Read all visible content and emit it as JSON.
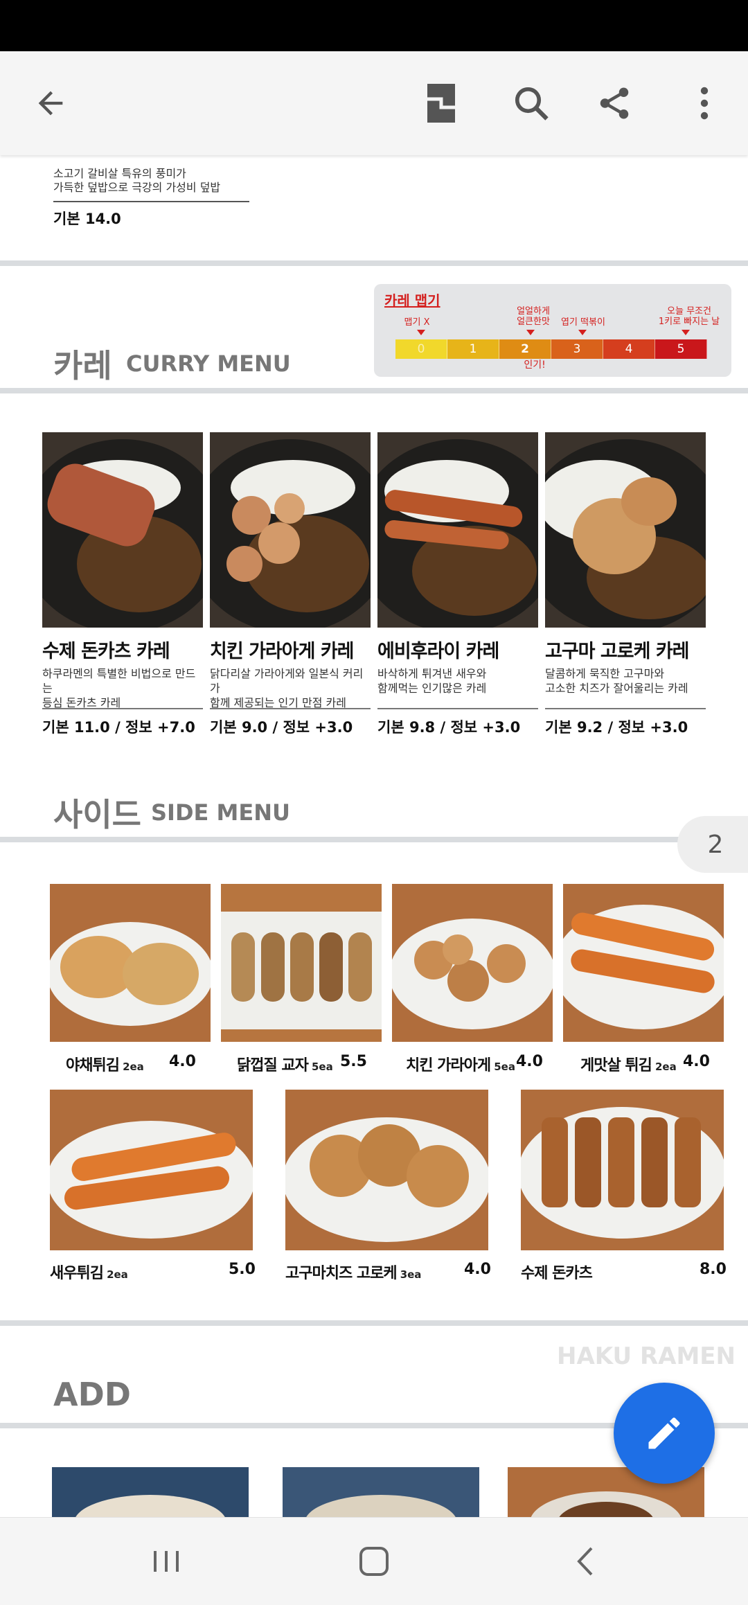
{
  "toolbar": {
    "back": "back-arrow-icon",
    "icons": [
      "page-icon",
      "search-icon",
      "share-icon",
      "more-icon"
    ]
  },
  "top_item": {
    "desc_line1": "소고기 갈비살 특유의 풍미가",
    "desc_line2": "가득한 덮밥으로 극강의 가성비 덮밥",
    "price": "기본  14.0"
  },
  "curry": {
    "title_ko": "카레",
    "title_en": "CURRY MENU",
    "spice": {
      "title": "카레 맵기",
      "labels": [
        "맵기 X",
        "얼얼하게\n얼큰한맛",
        "엽기 떡볶이",
        "오늘 무조건\n1키로 빠지는 날"
      ],
      "levels": [
        "0",
        "1",
        "2",
        "3",
        "4",
        "5"
      ],
      "popular": "인기!"
    },
    "items": [
      {
        "name": "수제 돈카츠 카레",
        "desc1": "하쿠라멘의 특별한 비법으로 만드는",
        "desc2": "등심 돈카츠 카레",
        "price": "기본  11.0   / 정보  +7.0"
      },
      {
        "name": "치킨 가라아게 카레",
        "desc1": "닭다리살 가라아게와 일본식 커리가",
        "desc2": "함께 제공되는 인기 만점 카레",
        "price": "기본  9.0   / 정보  +3.0"
      },
      {
        "name": "에비후라이 카레",
        "desc1": "바삭하게 튀겨낸 새우와",
        "desc2": "함께먹는 인기많은 카레",
        "price": "기본  9.8   / 정보  +3.0"
      },
      {
        "name": "고구마 고로케 카레",
        "desc1": "달콤하게 묵직한 고구마와",
        "desc2": "고소한 치즈가 잘어울리는 카레",
        "price": "기본  9.2   / 정보  +3.0"
      }
    ]
  },
  "side": {
    "title_ko": "사이드",
    "title_en": "SIDE MENU",
    "items": [
      {
        "name": "야채튀김",
        "qty": "2ea",
        "price": "4.0"
      },
      {
        "name": "닭껍질 교자",
        "qty": "5ea",
        "price": "5.5"
      },
      {
        "name": "치킨 가라아게",
        "qty": "5ea",
        "price": "4.0"
      },
      {
        "name": "게맛살 튀김",
        "qty": "2ea",
        "price": "4.0"
      },
      {
        "name": "새우튀김",
        "qty": "2ea",
        "price": "5.0"
      },
      {
        "name": "고구마치즈 고로케",
        "qty": "3ea",
        "price": "4.0"
      },
      {
        "name": "수제 돈카츠",
        "qty": "",
        "price": "8.0"
      }
    ]
  },
  "page_badge": "2",
  "brand": "HAKU RAMEN",
  "add": {
    "title": "ADD"
  },
  "colors": {
    "accent": "#1e6fe6",
    "red": "#d4201f"
  }
}
